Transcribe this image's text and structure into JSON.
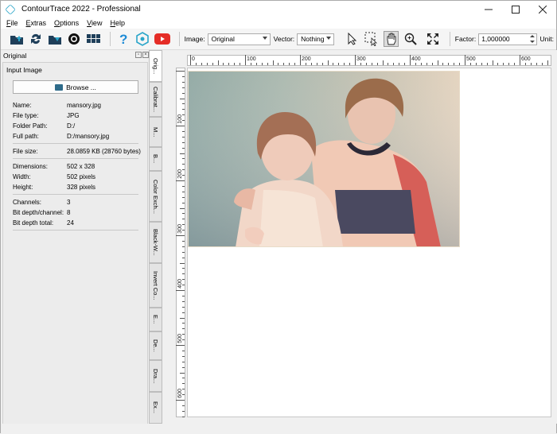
{
  "window": {
    "title": "ContourTrace 2022 - Professional",
    "controls": [
      "minimize",
      "maximize",
      "close"
    ]
  },
  "menu": [
    {
      "label": "File",
      "accel": "F"
    },
    {
      "label": "Extras",
      "accel": "E"
    },
    {
      "label": "Options",
      "accel": "O"
    },
    {
      "label": "View",
      "accel": "V"
    },
    {
      "label": "Help",
      "accel": "H"
    }
  ],
  "toolbar": {
    "icons": [
      "open-folder-icon",
      "refresh-icon",
      "save-folder-icon",
      "aperture-icon",
      "grid-icon",
      "help-icon",
      "hex-logo-icon",
      "youtube-icon"
    ],
    "image_label": "Image:",
    "image_value": "Original",
    "vector_label": "Vector:",
    "vector_value": "Nothing",
    "tools": [
      "pointer-icon",
      "select-region-icon",
      "hand-icon",
      "zoom-icon",
      "fit-screen-icon"
    ],
    "factor_label": "Factor:",
    "factor_value": "1,000000",
    "unit_label": "Unit:"
  },
  "panel": {
    "title": "Original",
    "group_title": "Input Image",
    "browse_label": "Browse ...",
    "info": [
      {
        "key": "Name:",
        "value": "mansory.jpg"
      },
      {
        "key": "File type:",
        "value": "JPG"
      },
      {
        "key": "Folder Path:",
        "value": "D:/"
      },
      {
        "key": "Full path:",
        "value": "D:/mansory.jpg"
      },
      {
        "key": "File size:",
        "value": "28.0859 KB (28760 bytes)"
      },
      {
        "key": "Dimensions:",
        "value": "502 x 328"
      },
      {
        "key": "Width:",
        "value": "502 pixels"
      },
      {
        "key": "Height:",
        "value": "328 pixels"
      },
      {
        "key": "Channels:",
        "value": "3"
      },
      {
        "key": "Bit depth/channel:",
        "value": "8"
      },
      {
        "key": "Bit depth total:",
        "value": "24"
      }
    ]
  },
  "vtabs": [
    "Orig...",
    "Calibrat...",
    "M...",
    "B...",
    "Color Exch...",
    "Black-W...",
    "Invert Co...",
    "E...",
    "De...",
    "Dra...",
    "Ex..."
  ],
  "ruler": {
    "h_labels": [
      "0",
      "100",
      "200",
      "300",
      "400",
      "500",
      "600"
    ],
    "v_labels": [
      "100",
      "200",
      "300",
      "400",
      "500",
      "600"
    ]
  },
  "colors": {
    "accent": "#2aa5c9",
    "youtube": "#e52d27",
    "help": "#1e8bd6"
  }
}
